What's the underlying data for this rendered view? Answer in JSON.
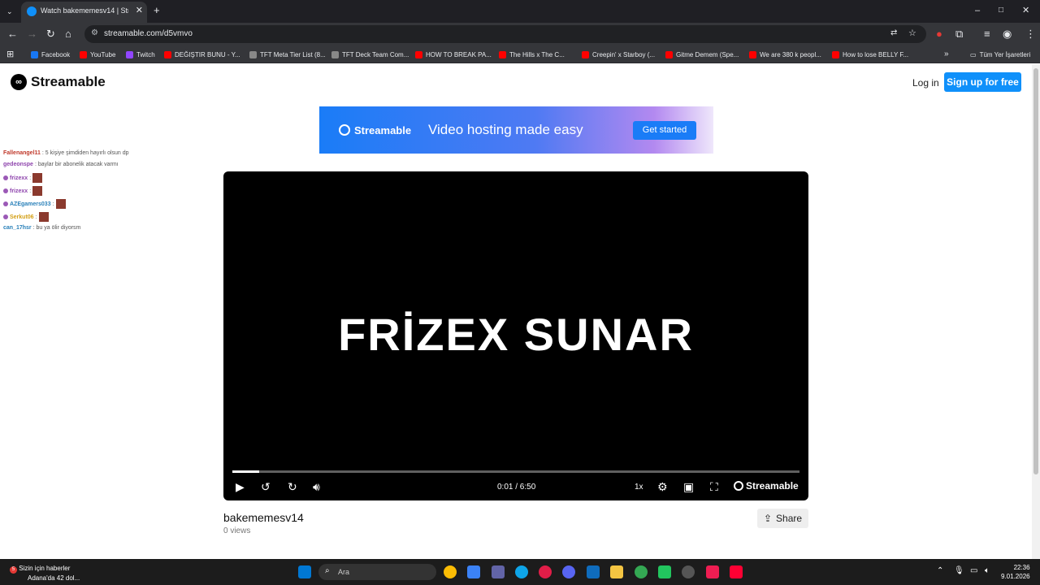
{
  "browser": {
    "tab_title": "Watch bakememesv14 | Stream",
    "url": "streamable.com/d5vmvo",
    "bookmarks": [
      {
        "label": "Facebook",
        "color": "#1877f2"
      },
      {
        "label": "YouTube",
        "color": "#ff0000"
      },
      {
        "label": "Twitch",
        "color": "#9146ff"
      },
      {
        "label": "DEĞIŞTIR BUNU - Y...",
        "color": "#ff0000"
      },
      {
        "label": "TFT Meta Tier List (8...",
        "color": "#888888"
      },
      {
        "label": "TFT Deck Team Com...",
        "color": "#888888"
      },
      {
        "label": "HOW TO BREAK PA...",
        "color": "#ff0000"
      },
      {
        "label": "The Hills x The C...",
        "color": "#ff0000"
      },
      {
        "label": "Creepin' x Starboy (...",
        "color": "#ff0000"
      },
      {
        "label": "Gitme Demem (Spe...",
        "color": "#ff0000"
      },
      {
        "label": "We are 380 k peopl...",
        "color": "#ff0000"
      },
      {
        "label": "How to lose BELLY F...",
        "color": "#ff0000"
      }
    ],
    "bookmarks_folder": "Tüm Yer İşaretleri"
  },
  "header": {
    "logo": "Streamable",
    "login": "Log in",
    "signup": "Sign up for free"
  },
  "banner": {
    "brand": "Streamable",
    "tagline": "Video hosting made easy",
    "cta": "Get started"
  },
  "chat": [
    {
      "user": "Fallenangel11",
      "color": "#c0392b",
      "msg": ": 5 kişiye şimdiden hayırlı olsun dp"
    },
    {
      "user": "gedeonspe",
      "color": "#8e44ad",
      "msg": ": baylar bir abonelik atacak varmı"
    },
    {
      "user": "frizexx",
      "color": "#8e44ad",
      "msg": ":",
      "emote": true
    },
    {
      "user": "frizexx",
      "color": "#8e44ad",
      "msg": ":",
      "emote": true
    },
    {
      "user": "AZEgamers033",
      "color": "#2980b9",
      "msg": ":",
      "emote": true
    },
    {
      "user": "Serkut06",
      "color": "#d4a017",
      "msg": ":",
      "emote": true
    },
    {
      "user": "can_17hsr",
      "color": "#2980b9",
      "msg": ": bu ya ölir diyorsm"
    }
  ],
  "player": {
    "overlay": "FRİZEX SUNAR",
    "time": "0:01 / 6:50",
    "progress": 0.047,
    "rate": "1x",
    "brand": "Streamable"
  },
  "video": {
    "title": "bakememesv14",
    "views": "0 views",
    "share": "Share"
  },
  "taskbar": {
    "news_title": "Sizin için haberler",
    "news_sub": "Adana'da 42 dol...",
    "news_badge": "5",
    "search": "Ara",
    "time": "22:36",
    "date": "9.01.2026"
  }
}
